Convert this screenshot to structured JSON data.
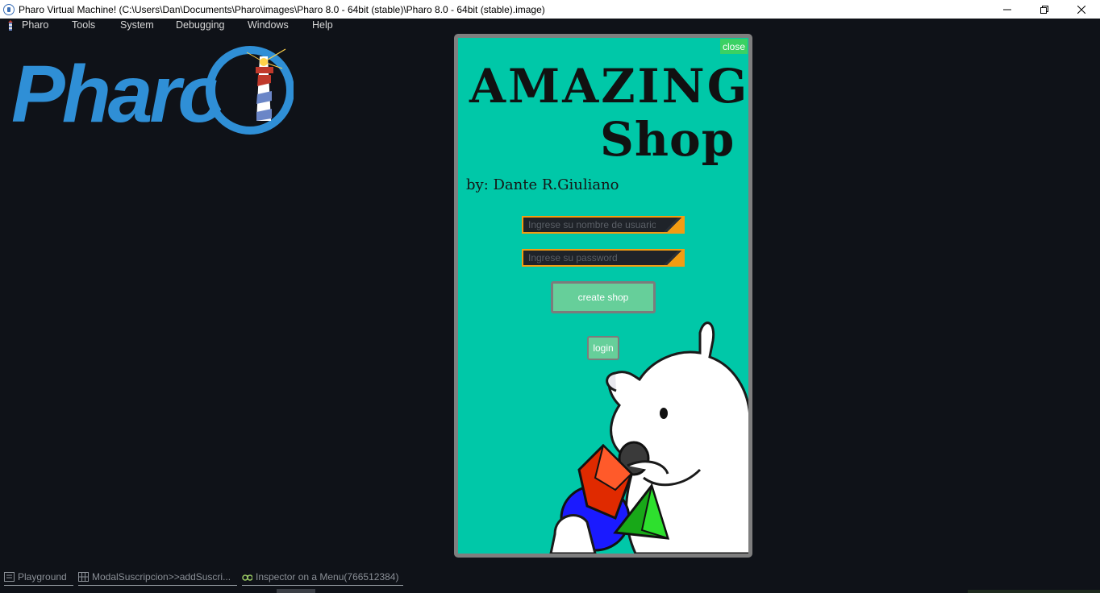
{
  "window": {
    "title": "Pharo Virtual Machine! (C:\\Users\\Dan\\Documents\\Pharo\\images\\Pharo 8.0 - 64bit (stable)\\Pharo 8.0 - 64bit (stable).image)"
  },
  "menubar": {
    "items": [
      "Pharo",
      "Tools",
      "System",
      "Debugging",
      "Windows",
      "Help"
    ]
  },
  "logo": {
    "text": "Pharo",
    "color": "#2f8fd6"
  },
  "modal": {
    "close_label": "close",
    "headline_line1": "AMAZING",
    "headline_line2": "Shop",
    "byline": "by: Dante R.Giuliano",
    "username_placeholder": "Ingrese su nombre de usuario",
    "password_placeholder": "Ingrese su password",
    "create_label": "create shop",
    "login_label": "login",
    "background": "#00c8a8",
    "button_color": "#66cf9a",
    "field_accent": "#f39c12"
  },
  "taskbar": {
    "items": [
      {
        "label": "Playground",
        "icon": "playground-icon"
      },
      {
        "label": "ModalSuscripcion>>addSuscri...",
        "icon": "browser-icon"
      },
      {
        "label": "Inspector on a Menu(766512384)",
        "icon": "inspector-icon"
      }
    ]
  }
}
